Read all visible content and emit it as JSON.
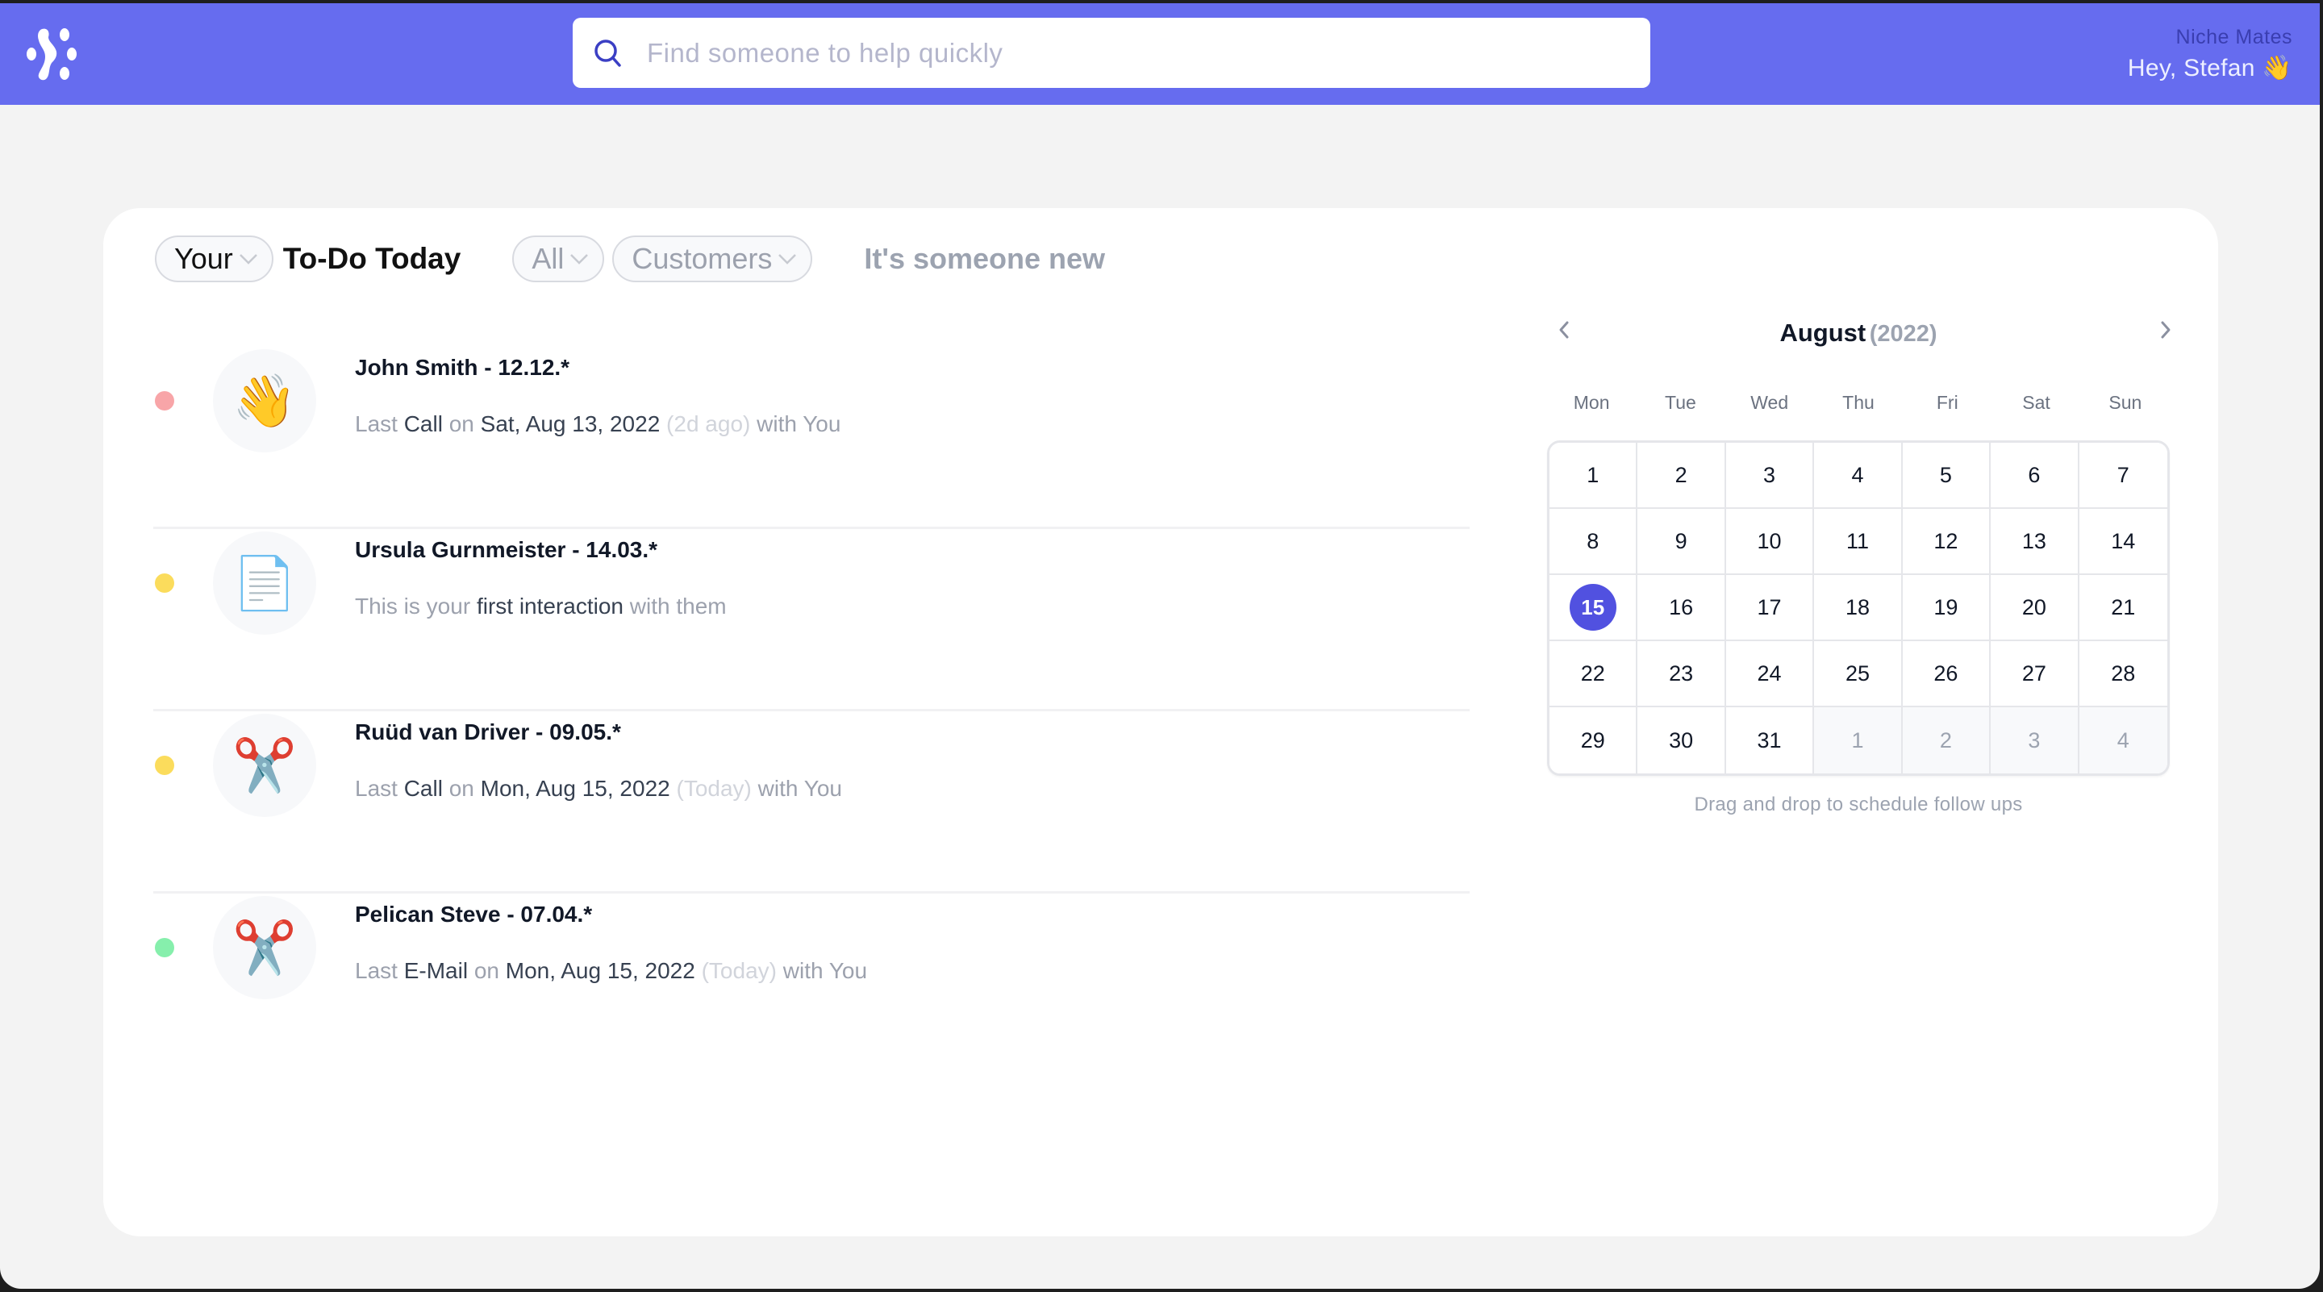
{
  "header": {
    "logo": "niche-mates-logo",
    "search": {
      "placeholder": "Find someone to help quickly",
      "value": ""
    },
    "brand": "Niche Mates",
    "greeting": "Hey, Stefan 👋"
  },
  "filters": {
    "scope": "Your",
    "title": "To-Do Today",
    "type": "All",
    "category": "Customers",
    "new_link": "It's someone new"
  },
  "colors": {
    "accent": "#666cef",
    "today": "#5151e0",
    "status_red": "#f8a5a8",
    "status_yellow": "#fbdc5c",
    "status_green": "#86efac"
  },
  "contacts": [
    {
      "status": "red",
      "status_color": "#f8a5a8",
      "avatar_icon": "waving-hand-icon",
      "avatar": "👋",
      "name": "John Smith - 12.12.*",
      "meta": [
        {
          "text": "Last ",
          "style": "muted"
        },
        {
          "text": "Call",
          "style": "strong"
        },
        {
          "text": " on ",
          "style": "muted"
        },
        {
          "text": "Sat, Aug 13, 2022",
          "style": "strong"
        },
        {
          "text": " (2d ago)",
          "style": "faint"
        },
        {
          "text": " with You",
          "style": "muted"
        }
      ]
    },
    {
      "status": "yellow",
      "status_color": "#fbdc5c",
      "avatar_icon": "document-icon",
      "avatar": "📄",
      "name": "Ursula Gurnmeister - 14.03.*",
      "meta": [
        {
          "text": "This is your ",
          "style": "muted"
        },
        {
          "text": "first interaction",
          "style": "strong"
        },
        {
          "text": " with them",
          "style": "muted"
        }
      ]
    },
    {
      "status": "yellow",
      "status_color": "#fbdc5c",
      "avatar_icon": "scissors-icon",
      "avatar": "✂️",
      "name": "Ruüd van Driver - 09.05.*",
      "meta": [
        {
          "text": "Last ",
          "style": "muted"
        },
        {
          "text": "Call",
          "style": "strong"
        },
        {
          "text": " on ",
          "style": "muted"
        },
        {
          "text": "Mon, Aug 15, 2022",
          "style": "strong"
        },
        {
          "text": " (Today)",
          "style": "faint"
        },
        {
          "text": " with You",
          "style": "muted"
        }
      ]
    },
    {
      "status": "green",
      "status_color": "#86efac",
      "avatar_icon": "scissors-icon",
      "avatar": "✂️",
      "name": "Pelican Steve - 07.04.*",
      "meta": [
        {
          "text": "Last ",
          "style": "muted"
        },
        {
          "text": "E-Mail",
          "style": "strong"
        },
        {
          "text": " on ",
          "style": "muted"
        },
        {
          "text": "Mon, Aug 15, 2022",
          "style": "strong"
        },
        {
          "text": " (Today)",
          "style": "faint"
        },
        {
          "text": " with You",
          "style": "muted"
        }
      ]
    }
  ],
  "calendar": {
    "month": "August",
    "year": "(2022)",
    "weekdays": [
      "Mon",
      "Tue",
      "Wed",
      "Thu",
      "Fri",
      "Sat",
      "Sun"
    ],
    "days": [
      {
        "d": "1"
      },
      {
        "d": "2"
      },
      {
        "d": "3"
      },
      {
        "d": "4"
      },
      {
        "d": "5"
      },
      {
        "d": "6"
      },
      {
        "d": "7"
      },
      {
        "d": "8"
      },
      {
        "d": "9"
      },
      {
        "d": "10"
      },
      {
        "d": "11"
      },
      {
        "d": "12"
      },
      {
        "d": "13"
      },
      {
        "d": "14"
      },
      {
        "d": "15",
        "today": true
      },
      {
        "d": "16"
      },
      {
        "d": "17"
      },
      {
        "d": "18"
      },
      {
        "d": "19"
      },
      {
        "d": "20"
      },
      {
        "d": "21"
      },
      {
        "d": "22"
      },
      {
        "d": "23"
      },
      {
        "d": "24"
      },
      {
        "d": "25"
      },
      {
        "d": "26"
      },
      {
        "d": "27"
      },
      {
        "d": "28"
      },
      {
        "d": "29"
      },
      {
        "d": "30"
      },
      {
        "d": "31"
      },
      {
        "d": "1",
        "other": true
      },
      {
        "d": "2",
        "other": true
      },
      {
        "d": "3",
        "other": true
      },
      {
        "d": "4",
        "other": true
      }
    ],
    "hint": "Drag and drop to schedule follow ups"
  }
}
